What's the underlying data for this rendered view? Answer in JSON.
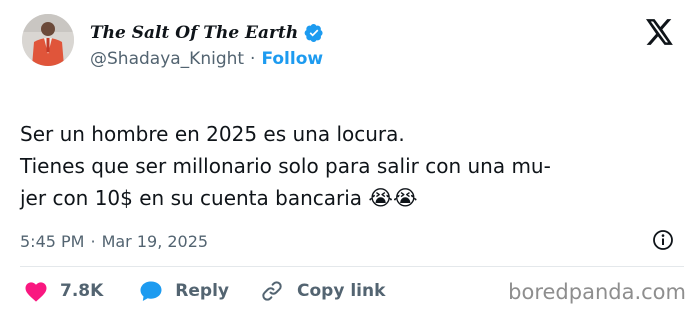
{
  "author": {
    "display_name": "The Salt Of The Earth",
    "handle": "@Shadaya_Knight",
    "separator": "·",
    "follow_label": "Follow"
  },
  "tweet": {
    "lines": [
      "Ser un hombre en 2025 es una locura.",
      "Tienes que ser millonario solo para salir con una mu-",
      "jer con 10$ en su cuenta bancaria"
    ],
    "emoji": "😭😭"
  },
  "meta": {
    "time": "5:45 PM",
    "separator": "·",
    "date": "Mar 19, 2025"
  },
  "actions": {
    "likes": "7.8K",
    "reply_label": "Reply",
    "copy_label": "Copy link"
  },
  "watermark": "boredpanda.com",
  "colors": {
    "accent": "#1d9bf0",
    "like": "#f91880",
    "text": "#0f1419",
    "muted": "#536471"
  },
  "icons": [
    "avatar",
    "verified-badge-icon",
    "x-logo-icon",
    "info-icon",
    "heart-icon",
    "reply-bubble-icon",
    "link-icon"
  ]
}
